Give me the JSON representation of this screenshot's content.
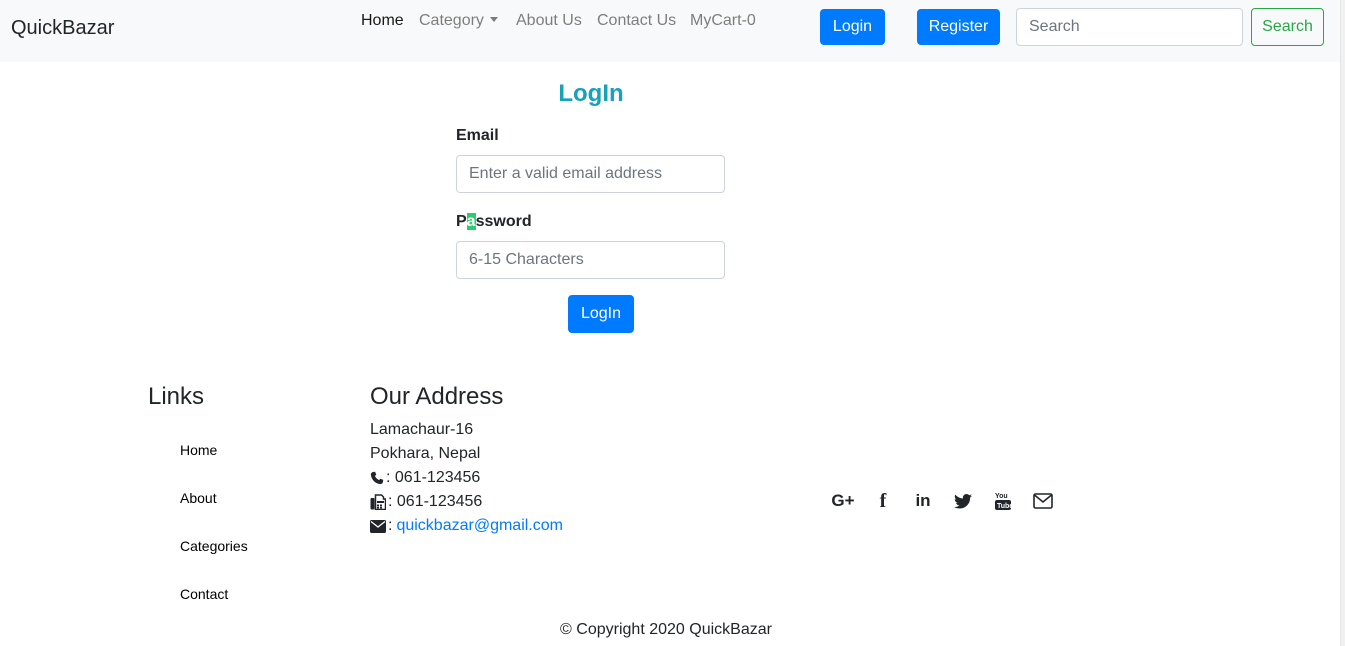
{
  "navbar": {
    "brand": "QuickBazar",
    "links": {
      "home": "Home",
      "category": "Category",
      "about": "About Us",
      "contact": "Contact Us",
      "cart": "MyCart-0"
    },
    "login_button": "Login",
    "register_button": "Register",
    "search": {
      "placeholder": "Search",
      "button": "Search"
    }
  },
  "login_form": {
    "title": "LogIn",
    "email_label": "Email",
    "email_placeholder": "Enter a valid email address",
    "password_label_parts": [
      "P",
      "a",
      "ssword"
    ],
    "password_placeholder": "6-15 Characters",
    "submit": "LogIn"
  },
  "footer": {
    "links_heading": "Links",
    "links": [
      "Home",
      "About",
      "Categories",
      "Contact"
    ],
    "address_heading": "Our Address",
    "address_line1": "Lamachaur-16",
    "address_line2": "Pokhara, Nepal",
    "phone": ": 061-123456",
    "fax": ": 061-123456",
    "email_prefix": ":",
    "email": "quickbazar@gmail.com",
    "social_icons": [
      "google-plus-icon",
      "facebook-icon",
      "linkedin-icon",
      "twitter-icon",
      "youtube-icon",
      "envelope-icon"
    ],
    "social_labels": {
      "google_plus": "G+",
      "facebook": "f",
      "linkedin": "in"
    },
    "copyright": "© Copyright 2020 QuickBazar"
  },
  "colors": {
    "primary": "#007bff",
    "success": "#28a745",
    "info": "#17a2b8",
    "highlight": "#2ecc71",
    "navbar_bg": "#f8f9fa"
  }
}
